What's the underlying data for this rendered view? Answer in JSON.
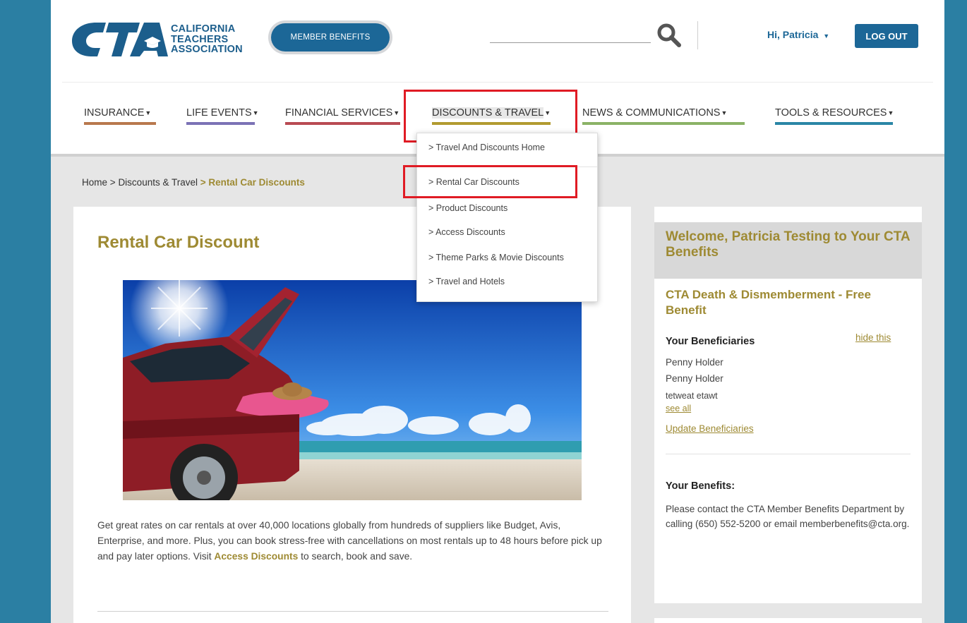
{
  "logo": {
    "lines": [
      "CALIFORNIA",
      "TEACHERS",
      "ASSOCIATION"
    ],
    "mark": "CTA"
  },
  "header": {
    "member_benefits": "MEMBER BENEFITS",
    "greeting": "Hi, Patricia",
    "logout": "LOG OUT"
  },
  "nav": [
    {
      "label": "INSURANCE",
      "color": "#b8784d"
    },
    {
      "label": "LIFE EVENTS",
      "color": "#7b72b5"
    },
    {
      "label": "FINANCIAL SERVICES",
      "color": "#b84a52"
    },
    {
      "label": "DISCOUNTS & TRAVEL",
      "color": "#b19a2f"
    },
    {
      "label": "NEWS & COMMUNICATIONS",
      "color": "#8bb266"
    },
    {
      "label": "TOOLS & RESOURCES",
      "color": "#2a86a6"
    }
  ],
  "dropdown": [
    "> Travel And Discounts Home",
    "> Rental Car Discounts",
    "> Product Discounts",
    "> Access Discounts",
    "> Theme Parks & Movie Discounts",
    "> Travel and Hotels"
  ],
  "breadcrumb": {
    "home": "Home",
    "section": "Discounts & Travel",
    "current": "Rental Car Discounts",
    "sep": ">"
  },
  "main": {
    "title": "Rental Car Discount",
    "body_before": "Get great rates on car rentals at over 40,000 locations globally from hundreds of suppliers like Budget, Avis, Enterprise, and more. Plus, you can book stress-free with cancellations on most rentals up to 48 hours before pick up and pay later options. Visit ",
    "body_link": "Access Discounts",
    "body_after": " to search, book and save."
  },
  "sidebar": {
    "welcome": "Welcome, Patricia Testing to Your CTA Benefits",
    "benefit_title": "CTA Death & Dismemberment - Free Benefit",
    "beneficiaries_label": "Your Beneficiaries",
    "hide_link": "hide this",
    "beneficiaries": [
      "Penny Holder",
      "Penny Holder",
      "tetweat etawt"
    ],
    "see_all": "see all",
    "update": "Update Beneficiaries",
    "benefits_label": "Your Benefits:",
    "benefits_text": "Please contact the CTA Member Benefits Department by calling (650) 552-5200 or email memberbenefits@cta.org."
  },
  "colors": {
    "brand_blue": "#1c6797",
    "gold": "#9e8a33",
    "highlight_red": "#e01b24",
    "page_frame": "#2b7fa3"
  }
}
